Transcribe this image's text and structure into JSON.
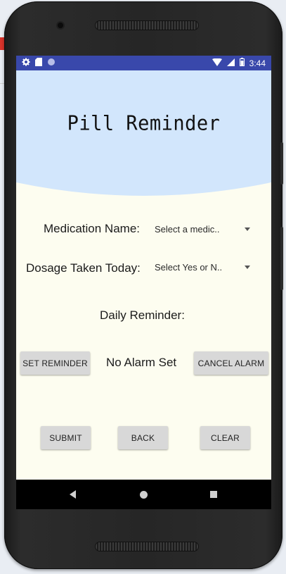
{
  "status_bar": {
    "left_icons": [
      "gear-icon",
      "sd-card-icon",
      "circle-icon"
    ],
    "right_icons": [
      "wifi-icon",
      "signal-icon",
      "battery-icon"
    ],
    "time": "3:44"
  },
  "header": {
    "title": "Pill Reminder",
    "background_color": "#d2e6fc"
  },
  "form": {
    "medication_label": "Medication Name:",
    "medication_value": "Select a medic..",
    "dosage_label": "Dosage Taken Today:",
    "dosage_value": "Select Yes or N..",
    "daily_reminder_label": "Daily Reminder:"
  },
  "alarm": {
    "set_button": "Set Reminder",
    "status": "No Alarm Set",
    "cancel_button": "Cancel Alarm"
  },
  "actions": {
    "submit": "Submit",
    "back": "Back",
    "clear": "Clear"
  },
  "colors": {
    "status_bar": "#3948ab",
    "screen_background": "#fdfdf0",
    "button": "#d8d8d8"
  }
}
